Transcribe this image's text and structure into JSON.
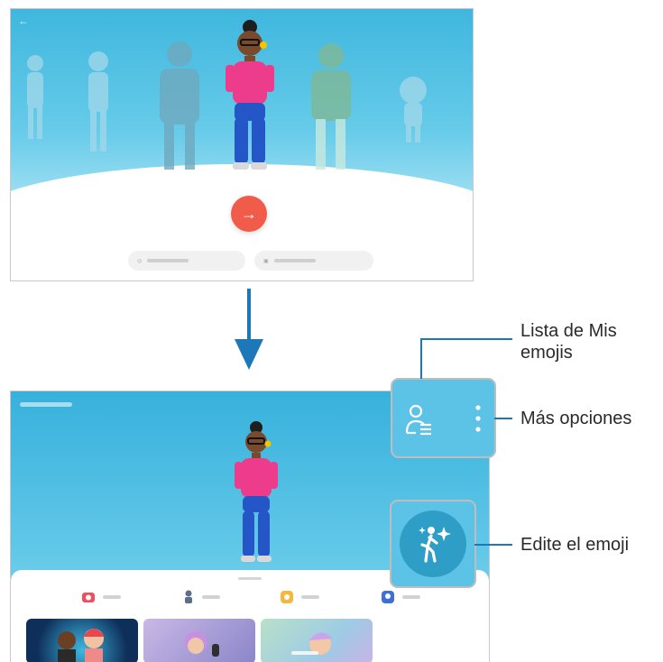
{
  "callouts": {
    "emoji_list": "Lista de Mis\nemojis",
    "emoji_list_line1": "Lista de Mis",
    "emoji_list_line2": "emojis",
    "more_options": "Más opciones",
    "edit_emoji": "Edite el emoji"
  },
  "icons": {
    "top_next": "arrow-right-icon",
    "transition": "arrow-down-icon",
    "emoji_list": "person-list-icon",
    "more_options": "vertical-dots-icon",
    "edit": "person-sparkle-icon"
  },
  "colors": {
    "sky": "#4fbfe3",
    "next_button": "#f15b4a",
    "leader": "#1d78b8",
    "callout_border": "#bdbdbd",
    "edit_circle": "#2f9ec7"
  }
}
